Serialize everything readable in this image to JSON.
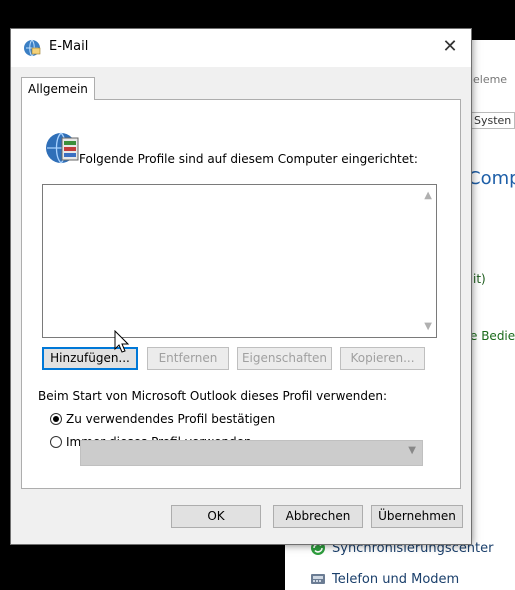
{
  "background": {
    "crumb": "eleme",
    "system_field": "Systen",
    "heading": "Comp",
    "link1": "it)",
    "link2": "e Bedie",
    "items": [
      {
        "label": "Synchronisierungscenter",
        "icon": "sync-icon"
      },
      {
        "label": "Telefon und Modem",
        "icon": "phone-modem-icon"
      }
    ]
  },
  "dialog": {
    "title": "E-Mail",
    "close_glyph": "✕",
    "tab_label": "Allgemein",
    "heading": "Folgende Profile sind auf diesem Computer eingerichtet:",
    "profiles": [],
    "buttons": {
      "add": "Hinzufügen...",
      "remove": "Entfernen",
      "properties": "Eigenschaften",
      "copy": "Kopieren..."
    },
    "startup_label": "Beim Start von Microsoft Outlook dieses Profil verwenden:",
    "radio_options": [
      {
        "label": "Zu verwendendes Profil bestätigen",
        "checked": true
      },
      {
        "label": "Immer dieses Profil verwenden",
        "checked": false
      }
    ],
    "profile_select_value": "",
    "footer": {
      "ok": "OK",
      "cancel": "Abbrechen",
      "apply": "Übernehmen"
    }
  },
  "colors": {
    "accent_focus": "#0078d7",
    "dialog_bg": "#f0f0f0",
    "disabled_text": "#a0a0a0"
  }
}
